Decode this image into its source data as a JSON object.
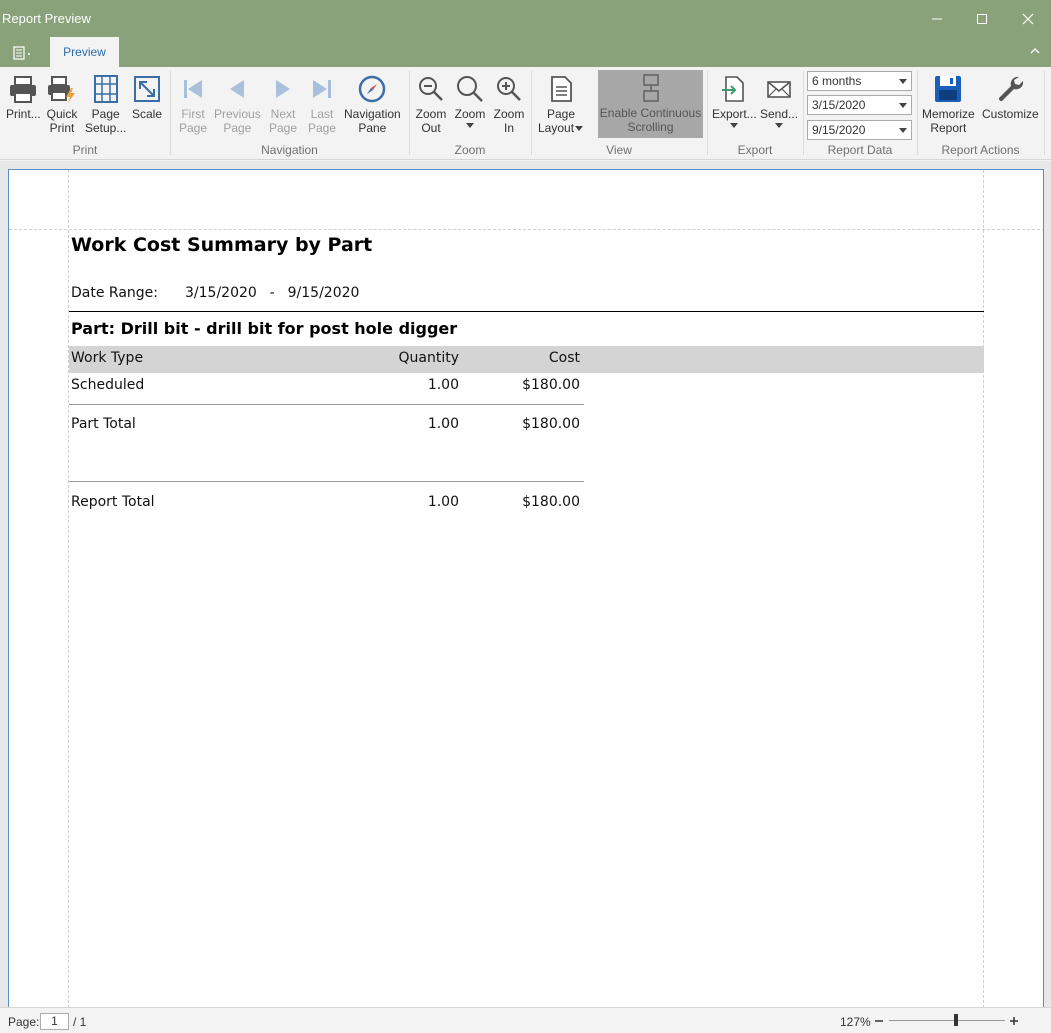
{
  "window": {
    "title": "Report Preview"
  },
  "tabs": {
    "active": "Preview"
  },
  "ribbon": {
    "print": {
      "print": "Print...",
      "quick_print": [
        "Quick",
        "Print"
      ],
      "page_setup": [
        "Page",
        "Setup..."
      ],
      "scale": "Scale",
      "group": "Print"
    },
    "navigation": {
      "first": [
        "First",
        "Page"
      ],
      "previous": [
        "Previous",
        "Page"
      ],
      "next": [
        "Next",
        "Page"
      ],
      "last": [
        "Last",
        "Page"
      ],
      "pane": [
        "Navigation",
        "Pane"
      ],
      "group": "Navigation"
    },
    "zoom": {
      "out": [
        "Zoom",
        "Out"
      ],
      "zoom": "Zoom",
      "in": [
        "Zoom",
        "In"
      ],
      "group": "Zoom"
    },
    "view": {
      "page_layout": [
        "Page",
        "Layout"
      ],
      "continuous": [
        "Enable Continuous",
        "Scrolling"
      ],
      "group": "View"
    },
    "export": {
      "export": "Export...",
      "send": "Send...",
      "group": "Export"
    },
    "report_data": {
      "period": "6 months",
      "start": "3/15/2020",
      "end": "9/15/2020",
      "group": "Report Data"
    },
    "report_actions": {
      "memorize": [
        "Memorize",
        "Report"
      ],
      "customize": "Customize",
      "group": "Report Actions"
    }
  },
  "report": {
    "title": "Work Cost Summary by Part",
    "date_range_label": "Date Range:",
    "date_range": "3/15/2020  -  9/15/2020",
    "part_heading": "Part: Drill bit - drill bit for post hole digger",
    "columns": [
      "Work Type",
      "Quantity",
      "Cost"
    ],
    "rows": [
      {
        "type": "Scheduled",
        "qty": "1.00",
        "cost": "$180.00"
      }
    ],
    "part_total": {
      "label": "Part Total",
      "qty": "1.00",
      "cost": "$180.00"
    },
    "report_total": {
      "label": "Report Total",
      "qty": "1.00",
      "cost": "$180.00"
    }
  },
  "status": {
    "page_label": "Page:",
    "page_value": "1",
    "page_count": "/ 1",
    "zoom": "127%",
    "zoom_level_percent": 127
  }
}
